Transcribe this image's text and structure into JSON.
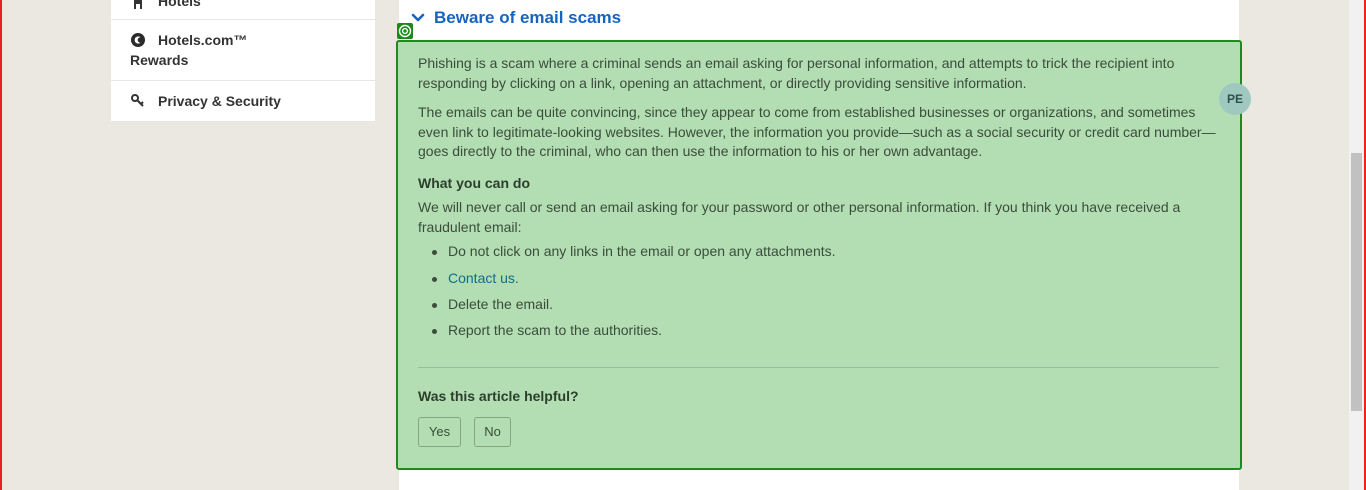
{
  "sidebar": {
    "items": [
      {
        "label": "Hotels",
        "icon": "hotel-icon"
      },
      {
        "label_line1": "Hotels.com™",
        "label_line2": "Rewards",
        "icon": "rewards-icon"
      },
      {
        "label": "Privacy & Security",
        "icon": "key-icon"
      }
    ]
  },
  "article": {
    "title": "Beware of email scams",
    "paragraph1": "Phishing is a scam where a criminal sends an email asking for personal information, and attempts to trick the recipient into responding by clicking on a link, opening an attachment, or directly providing sensitive information.",
    "paragraph2": "The emails can be quite convincing, since they appear to come from established businesses or organizations, and sometimes even link to legitimate-looking websites. However, the information you provide—such as a social security or credit card number—goes directly to the criminal, who can then use the information to his or her own advantage.",
    "subheading": "What you can do",
    "paragraph3": "We will never call or send an email asking for your password or other personal information. If you think you have received a fraudulent email:",
    "bullets": [
      "Do not click on any links in the email or open any attachments.",
      "Contact us.",
      "Delete the email.",
      "Report the scam to the authorities."
    ]
  },
  "feedback": {
    "question": "Was this article helpful?",
    "yes_label": "Yes",
    "no_label": "No"
  },
  "avatar": {
    "initials": "PE"
  },
  "colors": {
    "highlight_fill": "#b3ddb3",
    "highlight_border": "#1f8b1f",
    "title_blue": "#1565c0",
    "link": "#0f6f8a",
    "frame_red": "#e8231f"
  }
}
